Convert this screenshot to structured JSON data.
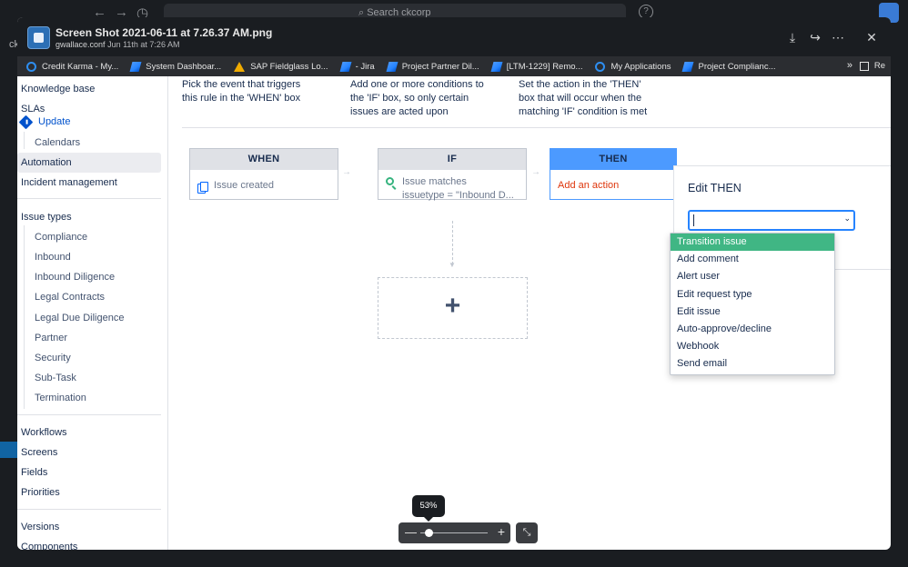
{
  "background": {
    "search_placeholder": "Search ckcorp",
    "left_label": "ck"
  },
  "modal": {
    "file_title": "Screen Shot 2021-06-11 at 7.26.37 AM.png",
    "file_author": "gwallace.conf",
    "file_date": "Jun 11th at 7:26 AM"
  },
  "bookmarks": [
    {
      "label": "Credit Karma - My...",
      "icon": "circle-icon"
    },
    {
      "label": "System Dashboar...",
      "icon": "jira-icon"
    },
    {
      "label": "SAP Fieldglass Lo...",
      "icon": "sap-icon"
    },
    {
      "label": "- Jira",
      "icon": "jira-icon"
    },
    {
      "label": "Project Partner Dil...",
      "icon": "jira-icon"
    },
    {
      "label": "[LTM-1229] Remo...",
      "icon": "jira-icon"
    },
    {
      "label": "My Applications",
      "icon": "circle-icon"
    },
    {
      "label": "Project Complianc...",
      "icon": "jira-icon"
    }
  ],
  "bookmarks_more": "»",
  "bookmarks_other": "Re",
  "sidebar": {
    "knowledge_base": "Knowledge base",
    "slas": "SLAs",
    "update": "Update",
    "calendars": "Calendars",
    "automation": "Automation",
    "incident_management": "Incident management",
    "issue_types": "Issue types",
    "issue_type_items": [
      "Compliance",
      "Inbound",
      "Inbound Diligence",
      "Legal Contracts",
      "Legal Due Diligence",
      "Partner",
      "Security",
      "Sub-Task",
      "Termination"
    ],
    "workflows": "Workflows",
    "screens": "Screens",
    "fields": "Fields",
    "priorities": "Priorities",
    "versions": "Versions",
    "components": "Components"
  },
  "instructions": {
    "when": [
      "Pick the event that triggers",
      "this rule in the 'WHEN' box"
    ],
    "if": [
      "Add one or more conditions to",
      "the 'IF' box, so only certain",
      "issues are acted upon"
    ],
    "then": [
      "Set the action in the 'THEN'",
      "box that will occur when the",
      "matching 'IF' condition is met"
    ]
  },
  "cards": {
    "when_title": "WHEN",
    "when_value": "Issue created",
    "if_title": "IF",
    "if_line1": "Issue matches",
    "if_line2": "issuetype = \"Inbound D...",
    "then_title": "THEN",
    "then_value": "Add an action",
    "add_symbol": "+"
  },
  "edit_then": {
    "title": "Edit THEN",
    "options": [
      "Transition issue",
      "Add comment",
      "Alert user",
      "Edit request type",
      "Edit issue",
      "Auto-approve/decline",
      "Webhook",
      "Send email"
    ],
    "selected_index": 0
  },
  "zoom": {
    "level": "53%",
    "fraction": 0.1
  },
  "colors": {
    "accent_blue": "#4c9aff",
    "selected_green": "#36b37e",
    "action_red": "#de350b",
    "link_blue": "#0052cc"
  }
}
